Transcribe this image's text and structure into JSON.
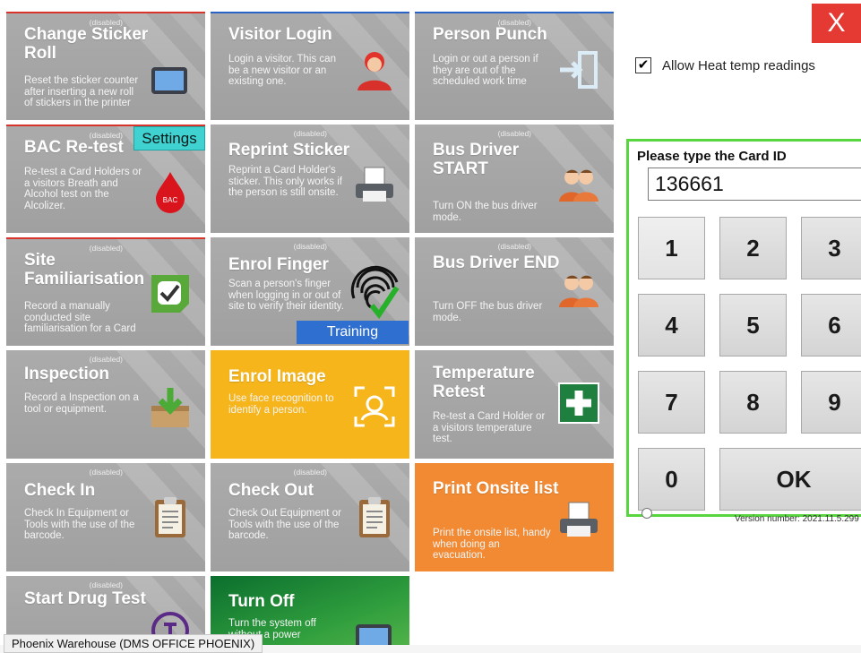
{
  "tiles": [
    {
      "title": "Change Sticker Roll",
      "disabled": "(disabled)",
      "desc": "Reset the sticker counter after inserting a new roll of stickers in the printer",
      "icon": "tablet-icon"
    },
    {
      "title": "Visitor Login",
      "desc": "Login a visitor. This can be a new visitor or an existing one.",
      "icon": "person-icon"
    },
    {
      "title": "Person Punch",
      "disabled": "(disabled)",
      "desc": "Login or out a person if they are out of the scheduled work time",
      "icon": "door-enter-icon"
    },
    {
      "title": "BAC Re-test",
      "disabled": "(disabled)",
      "desc": "Re-test a Card Holders or a visitors Breath and Alcohol test on the Alcolizer.",
      "icon": "blood-drop-icon",
      "badge": "BAC"
    },
    {
      "title": "Reprint Sticker",
      "disabled": "(disabled)",
      "desc": "Reprint a Card Holder's sticker. This only works if the person is still onsite.",
      "icon": "printer-icon"
    },
    {
      "title": "Bus Driver START",
      "disabled": "(disabled)",
      "desc": "Turn ON the bus driver mode.",
      "icon": "people-icon"
    },
    {
      "title": "Site Familiarisation",
      "disabled": "(disabled)",
      "desc": "Record a manually conducted site familiarisation for a Card",
      "icon": "checkbox-icon"
    },
    {
      "title": "Enrol Finger",
      "disabled": "(disabled)",
      "desc": "Scan a person's finger when logging in or out of site to verify their identity.",
      "icon": "fingerprint-icon"
    },
    {
      "title": "Bus Driver END",
      "disabled": "(disabled)",
      "desc": "Turn OFF the bus driver mode.",
      "icon": "people-icon"
    },
    {
      "title": "Inspection",
      "disabled": "(disabled)",
      "desc": "Record a Inspection on a tool or equipment.",
      "icon": "inbox-download-icon"
    },
    {
      "title": "Enrol Image",
      "desc": "Use face recognition to identify a person.",
      "icon": "face-scan-icon"
    },
    {
      "title": "Temperature Retest",
      "desc": "Re-test a Card Holder or a visitors temperature test.",
      "icon": "first-aid-icon"
    },
    {
      "title": "Check In",
      "disabled": "(disabled)",
      "desc": "Check In Equipment or Tools with the use of the barcode.",
      "icon": "clipboard-icon"
    },
    {
      "title": "Check Out",
      "disabled": "(disabled)",
      "desc": "Check Out Equipment or Tools with the use of the barcode.",
      "icon": "clipboard-icon"
    },
    {
      "title": "Print Onsite list",
      "desc": "Print the onsite list, handy when doing an evacuation.",
      "icon": "printer-icon"
    },
    {
      "title": "Start Drug Test",
      "disabled": "(disabled)",
      "desc": "",
      "icon": "drug-test-icon"
    },
    {
      "title": "Turn Off",
      "desc": "Turn the system off without a power",
      "icon": "tablet-icon"
    }
  ],
  "settings_label": "Settings",
  "training_label": "Training",
  "close_label": "X",
  "allow_heat": {
    "label": "Allow Heat temp readings",
    "checked": true,
    "mark": "✔"
  },
  "keypad": {
    "label": "Please type the Card ID",
    "value": "136661",
    "keys": [
      "1",
      "2",
      "3",
      "4",
      "5",
      "6",
      "7",
      "8",
      "9",
      "0"
    ],
    "ok": "OK"
  },
  "version": "Version number: 2021.11.5.299",
  "status": "Phoenix Warehouse (DMS OFFICE PHOENIX)",
  "colors": {
    "accent_green": "#59d53f",
    "close_red": "#e53a33",
    "tile_yellow": "#f6b51b",
    "tile_orange": "#f28a33"
  }
}
